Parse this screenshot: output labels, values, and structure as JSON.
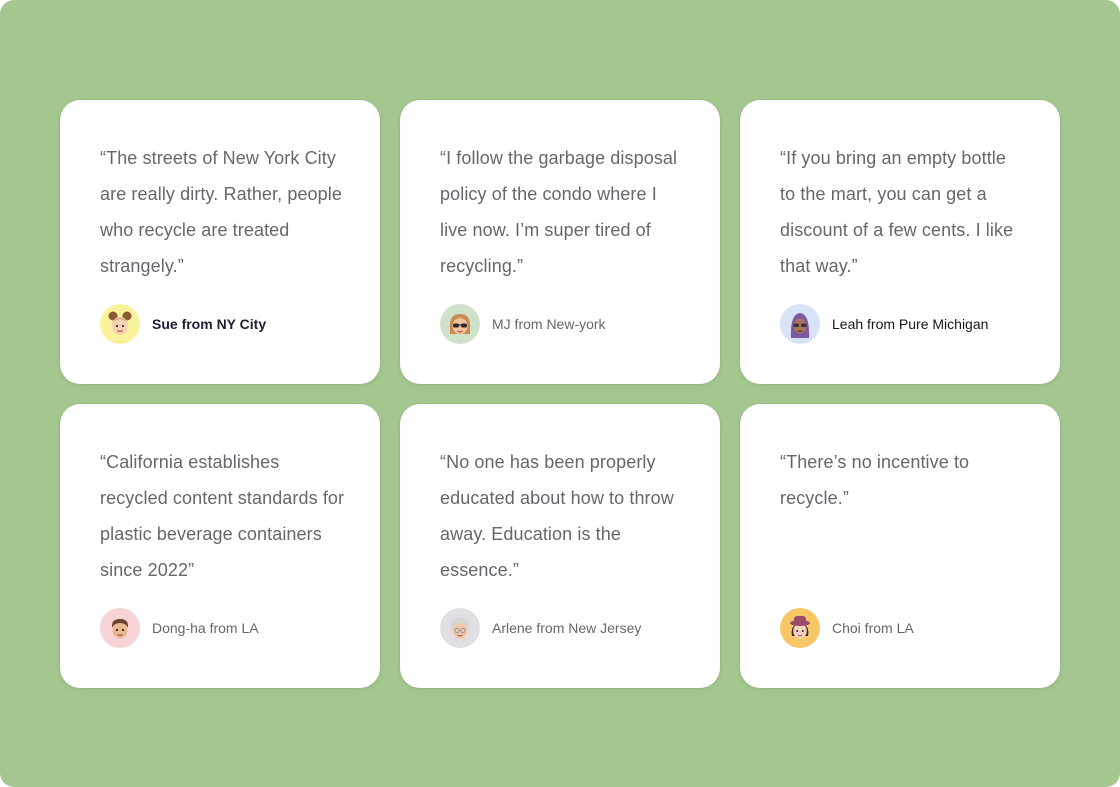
{
  "colors": {
    "background": "#a3c78e",
    "card": "#ffffff",
    "quote_text": "#64676d"
  },
  "testimonials": [
    {
      "quote": "“The streets of New York City are really dirty. Rather, people who recycle are treated strangely.”",
      "author": "Sue from NY City",
      "avatar_icon": "girl-buns-memoji-icon",
      "avatar_bg": "#f8f39a"
    },
    {
      "quote": "“I follow the garbage disposal policy of the condo where I live now. I’m super tired of recycling.”",
      "author": "MJ from New-york",
      "avatar_icon": "woman-sunglasses-memoji-icon",
      "avatar_bg": "#cfe0cb"
    },
    {
      "quote": "“If you bring an empty bottle to the mart, you can get a discount of a few cents. I like that way.”",
      "author": "Leah from Pure Michigan",
      "avatar_icon": "woman-hijab-memoji-icon",
      "avatar_bg": "#d8e3f8"
    },
    {
      "quote": "“California establishes recycled content standards for plastic beverage containers since 2022”",
      "author": "Dong-ha from LA",
      "avatar_icon": "boy-memoji-icon",
      "avatar_bg": "#f8d3d6"
    },
    {
      "quote": "“No one has been properly educated about how to throw away. Education is the essence.”",
      "author": "Arlene from New Jersey",
      "avatar_icon": "elderly-woman-memoji-icon",
      "avatar_bg": "#e1dfe4"
    },
    {
      "quote": "“There’s no incentive to recycle.”",
      "author": "Choi from LA",
      "avatar_icon": "girl-hat-memoji-icon",
      "avatar_bg": "#f6c667"
    }
  ]
}
